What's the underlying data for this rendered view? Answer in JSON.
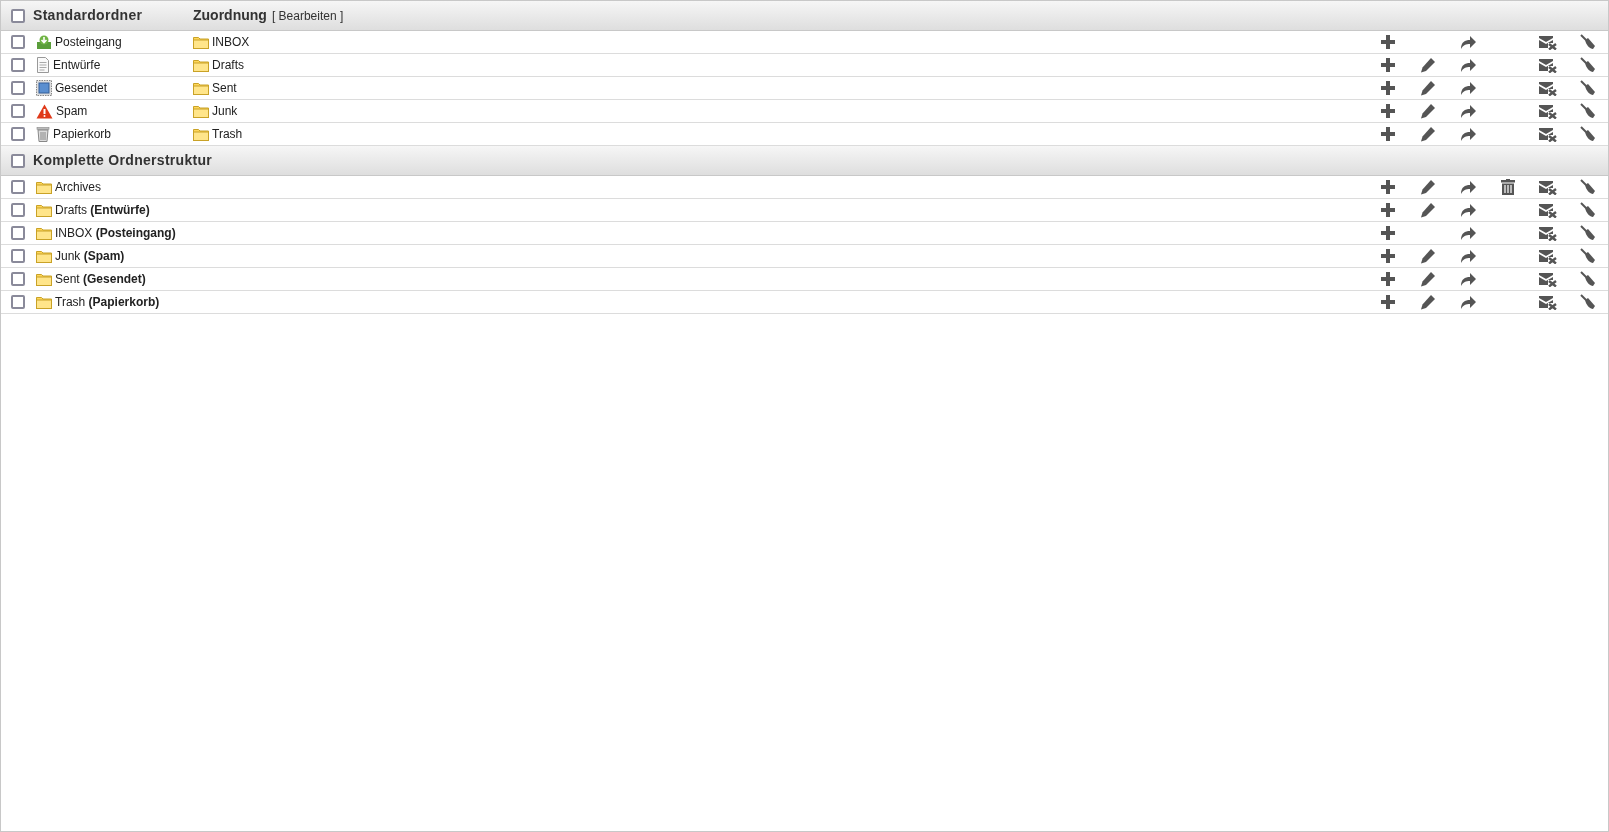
{
  "sections": [
    {
      "title": "Standardordner",
      "checked": false,
      "mapping_header": "Zuordnung",
      "edit_link": "[ Bearbeiten ]",
      "rows": [
        {
          "name": "Posteingang",
          "kind": "inbox",
          "mapping": "INBOX",
          "checked": false,
          "renamable": false,
          "deletable": false
        },
        {
          "name": "Entwürfe",
          "kind": "drafts",
          "mapping": "Drafts",
          "checked": false,
          "renamable": true,
          "deletable": false
        },
        {
          "name": "Gesendet",
          "kind": "sent",
          "mapping": "Sent",
          "checked": false,
          "renamable": true,
          "deletable": false
        },
        {
          "name": "Spam",
          "kind": "spam",
          "mapping": "Junk",
          "checked": false,
          "renamable": true,
          "deletable": false
        },
        {
          "name": "Papierkorb",
          "kind": "trash",
          "mapping": "Trash",
          "checked": false,
          "renamable": true,
          "deletable": false
        }
      ]
    },
    {
      "title": "Komplette Ordnerstruktur",
      "checked": false,
      "rows": [
        {
          "name": "Archives",
          "kind": "folder",
          "checked": false,
          "renamable": true,
          "deletable": true
        },
        {
          "name": "Drafts **(Entwürfe)**",
          "kind": "folder",
          "checked": false,
          "renamable": true,
          "deletable": false
        },
        {
          "name": "INBOX **(Posteingang)**",
          "kind": "folder",
          "checked": false,
          "renamable": false,
          "deletable": false
        },
        {
          "name": "Junk **(Spam)**",
          "kind": "folder",
          "checked": false,
          "renamable": true,
          "deletable": false
        },
        {
          "name": "Sent **(Gesendet)**",
          "kind": "folder",
          "checked": false,
          "renamable": true,
          "deletable": false
        },
        {
          "name": "Trash **(Papierkorb)**",
          "kind": "folder",
          "checked": false,
          "renamable": true,
          "deletable": false
        }
      ]
    }
  ]
}
